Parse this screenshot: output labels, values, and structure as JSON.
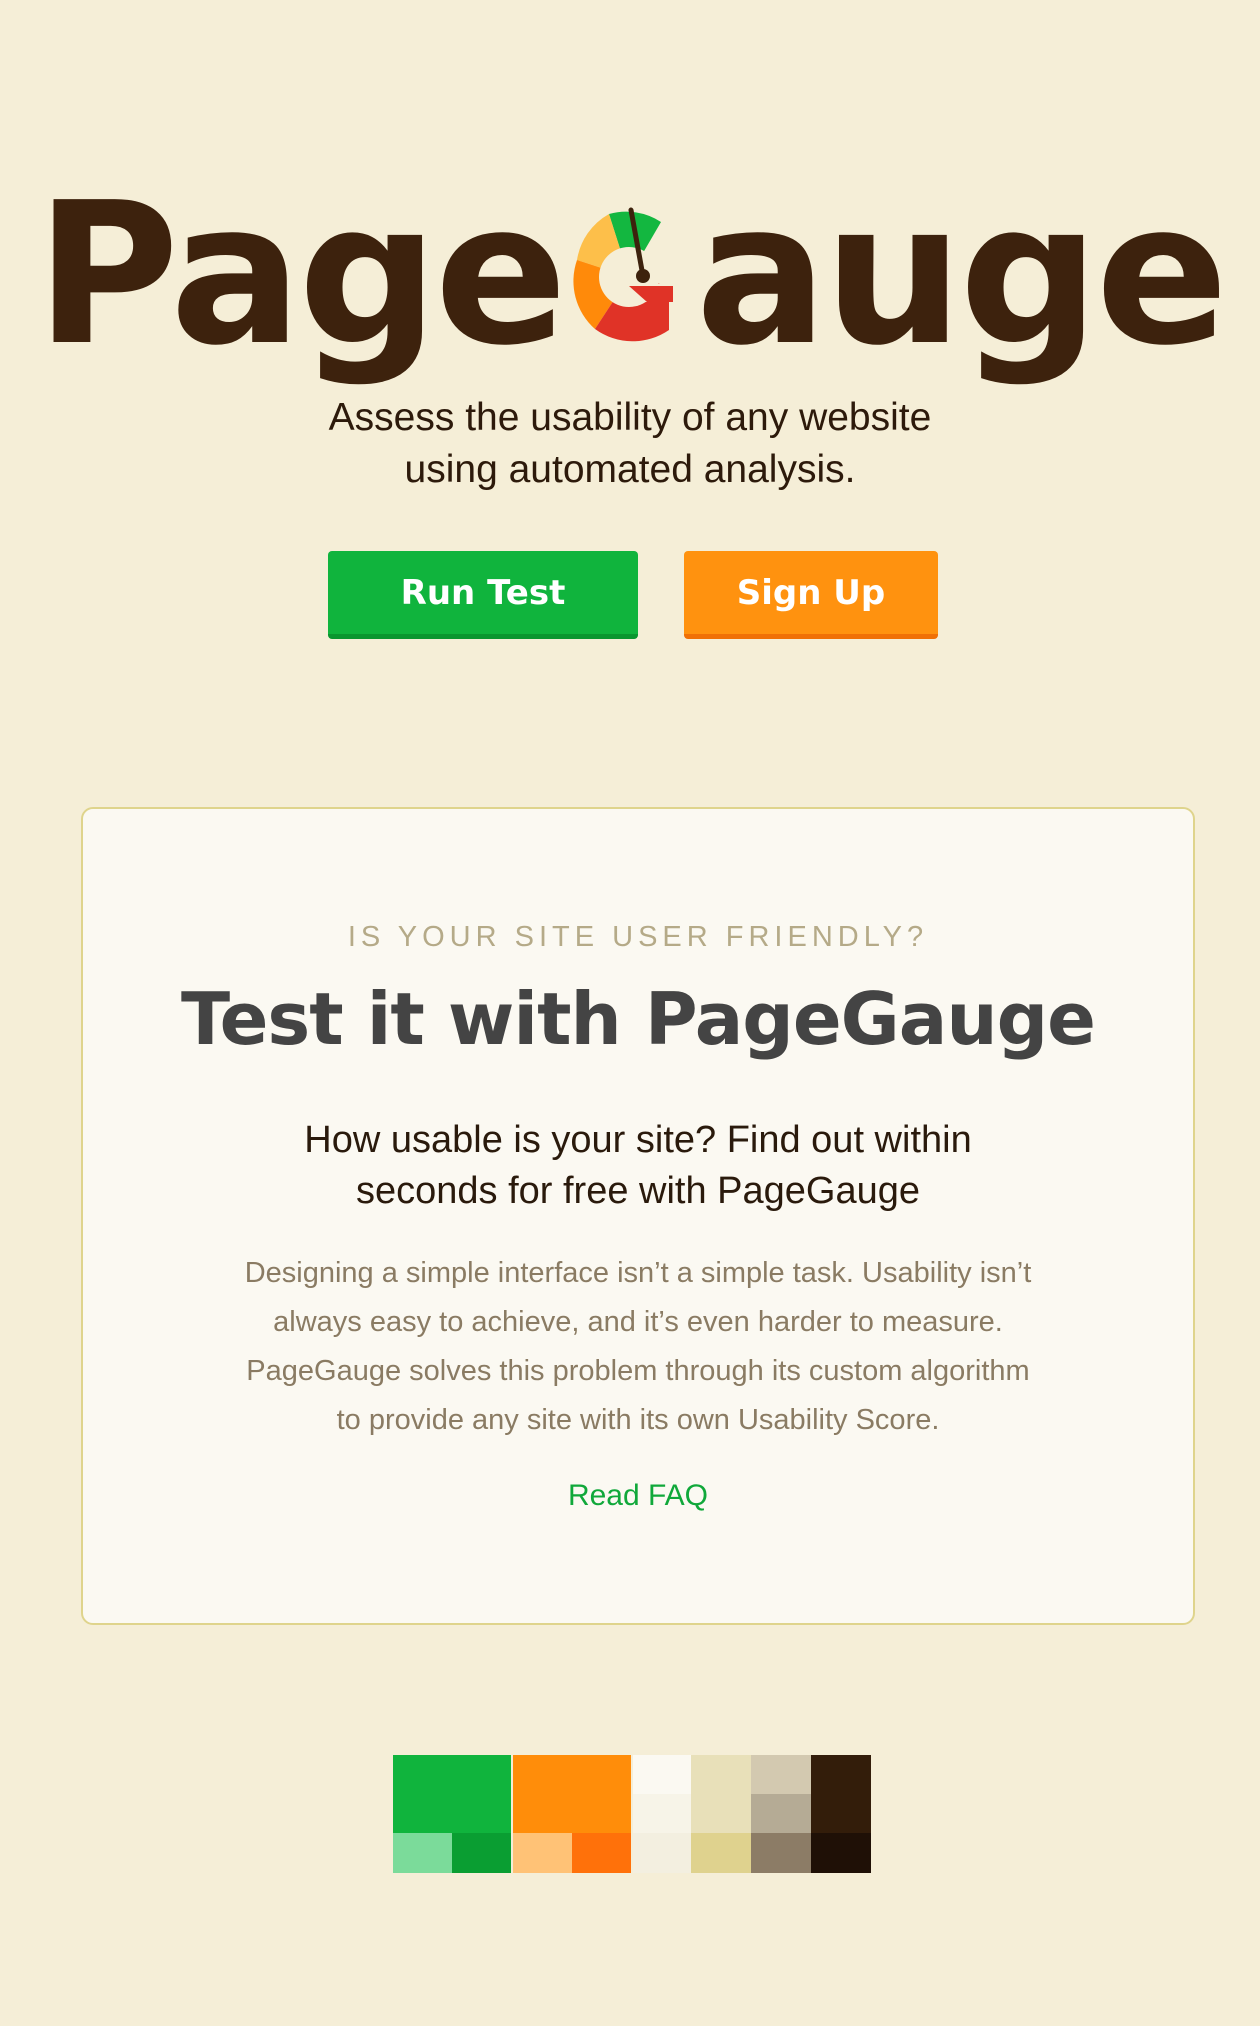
{
  "logo": {
    "text_before": "Page",
    "text_after": "auge",
    "gauge_icon": "gauge-letter-g-icon"
  },
  "tagline": {
    "line1": "Assess the usability of any website",
    "line2": "using automated analysis."
  },
  "buttons": {
    "run_test": "Run Test",
    "sign_up": "Sign Up"
  },
  "card": {
    "eyebrow": "IS YOUR SITE USER FRIENDLY?",
    "headline": "Test it with PageGauge",
    "subhead_line1": "How usable is your site? Find out within",
    "subhead_line2": "seconds for free with PageGauge",
    "body_line1": "Designing a simple interface isn’t a simple task. Usability isn’t",
    "body_line2": "always easy to achieve, and it’s even harder to measure.",
    "body_line3": "PageGauge solves this problem through its custom algorithm",
    "body_line4": "to provide any site with its own Usability Score.",
    "faq_link": "Read FAQ"
  },
  "colors": {
    "background": "#f5eed7",
    "brand_brown": "#3d220d",
    "green": "#10b43d",
    "orange": "#ff920f",
    "card_bg": "#fbf9f2",
    "card_border": "#dfd48c",
    "link_green": "#10a83a"
  },
  "palette": {
    "swatches": [
      "#10b43d",
      "#7bdb9a",
      "#0a9e32",
      "#ff8d0a",
      "#ffc276",
      "#ff710a",
      "#fbf9f2",
      "#f7f4e8",
      "#f3efe0",
      "#e8e0b9",
      "#dfd28e",
      "#d8cc88",
      "#d3c9b0",
      "#b5ab95",
      "#8c7c66",
      "#331d0a",
      "#2a1709",
      "#1f1006"
    ]
  }
}
